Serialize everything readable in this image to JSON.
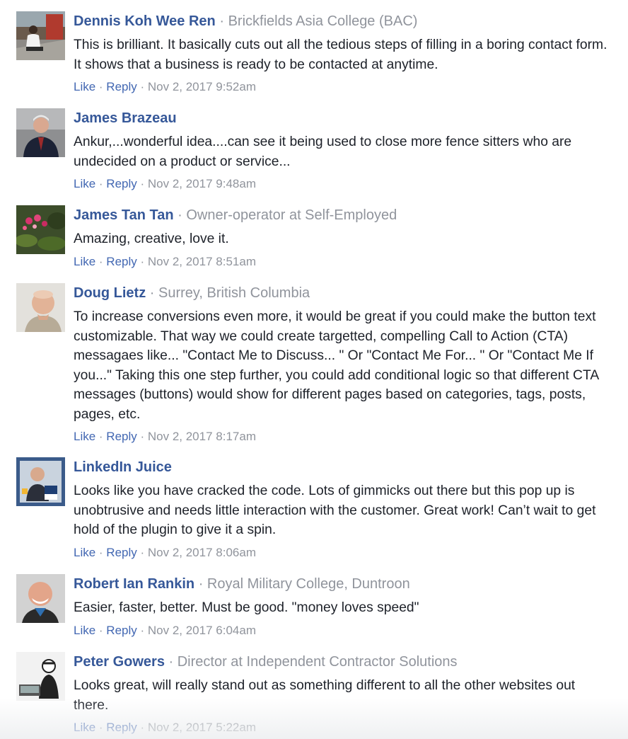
{
  "comments": [
    {
      "author": "Dennis Koh Wee Ren",
      "sep": " · ",
      "affiliation": "Brickfields Asia College (BAC)",
      "text": "This is brilliant. It basically cuts out all the tedious steps of filling in a boring contact form. It shows that a business is ready to be contacted at anytime.",
      "like": "Like",
      "reply": "Reply",
      "dot": " · ",
      "timestamp": "Nov 2, 2017 9:52am"
    },
    {
      "author": "James Brazeau",
      "sep": "",
      "affiliation": "",
      "text": "Ankur,...wonderful idea....can see it being used to close more fence sitters who are undecided on a product or service...",
      "like": "Like",
      "reply": "Reply",
      "dot": " · ",
      "timestamp": "Nov 2, 2017 9:48am"
    },
    {
      "author": "James Tan Tan",
      "sep": " · ",
      "affiliation": "Owner-operator at Self-Employed",
      "text": "Amazing, creative, love it.",
      "like": "Like",
      "reply": "Reply",
      "dot": " · ",
      "timestamp": "Nov 2, 2017 8:51am"
    },
    {
      "author": "Doug Lietz",
      "sep": " · ",
      "affiliation": "Surrey, British Columbia",
      "text": "To increase conversions even more, it would be great if you could make the button text customizable. That way we could create targetted, compelling Call to Action (CTA) messagaes like... \"Contact Me to Discuss... \" Or \"Contact Me For... \" Or \"Contact Me If you...\" Taking this one step further, you could add conditional logic so that different CTA messages (buttons) would show for different pages based on categories, tags, posts, pages, etc.",
      "like": "Like",
      "reply": "Reply",
      "dot": " · ",
      "timestamp": "Nov 2, 2017 8:17am"
    },
    {
      "author": "LinkedIn Juice",
      "sep": "",
      "affiliation": "",
      "text": "Looks like you have cracked the code. Lots of gimmicks out there but this pop up is unobtrusive and needs little interaction with the customer. Great work! Can’t wait to get hold of the plugin to give it a spin.",
      "like": "Like",
      "reply": "Reply",
      "dot": " · ",
      "timestamp": "Nov 2, 2017 8:06am"
    },
    {
      "author": "Robert Ian Rankin",
      "sep": " · ",
      "affiliation": "Royal Military College, Duntroon",
      "text": "Easier, faster, better. Must be good. \"money loves speed\"",
      "like": "Like",
      "reply": "Reply",
      "dot": " · ",
      "timestamp": "Nov 2, 2017 6:04am"
    },
    {
      "author": "Peter Gowers",
      "sep": " · ",
      "affiliation": "Director at Independent Contractor Solutions",
      "text": "Looks great, will really stand out as something different to all the other websites out there.",
      "like": "Like",
      "reply": "Reply",
      "dot": " · ",
      "timestamp": "Nov 2, 2017 5:22am"
    }
  ],
  "colors": {
    "author_link": "#365899",
    "action_link": "#4267b2",
    "muted": "#90949c",
    "body_text": "#1d2129"
  }
}
